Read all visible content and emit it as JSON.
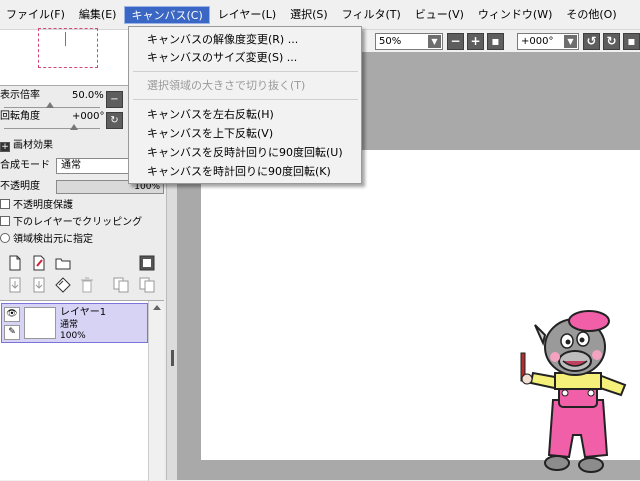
{
  "menubar": {
    "items": [
      {
        "label": "ファイル(F)",
        "active": false
      },
      {
        "label": "編集(E)",
        "active": false
      },
      {
        "label": "キャンバス(C)",
        "active": true
      },
      {
        "label": "レイヤー(L)",
        "active": false
      },
      {
        "label": "選択(S)",
        "active": false
      },
      {
        "label": "フィルタ(T)",
        "active": false
      },
      {
        "label": "ビュー(V)",
        "active": false
      },
      {
        "label": "ウィンドウ(W)",
        "active": false
      },
      {
        "label": "その他(O)",
        "active": false
      }
    ]
  },
  "canvas_menu": {
    "items": [
      {
        "label": "キャンバスの解像度変更(R) ...",
        "enabled": true
      },
      {
        "label": "キャンバスのサイズ変更(S) ...",
        "enabled": true
      },
      {
        "label": "選択領域の大きさで切り抜く(T)",
        "enabled": false
      },
      {
        "label": "キャンバスを左右反転(H)",
        "enabled": true
      },
      {
        "label": "キャンバスを上下反転(V)",
        "enabled": true
      },
      {
        "label": "キャンバスを反時計回りに90度回転(U)",
        "enabled": true
      },
      {
        "label": "キャンバスを時計回りに90度回転(K)",
        "enabled": true
      }
    ]
  },
  "toolbar": {
    "zoom_value": "50%",
    "rotation_value": "+000°"
  },
  "left_panel": {
    "zoom_label": "表示倍率",
    "zoom_value": "50.0%",
    "rotation_label": "回転角度",
    "rotation_value": "+000°",
    "texture_label": "画材効果",
    "blend_mode_label": "合成モード",
    "blend_mode_value": "通常",
    "opacity_label": "不透明度",
    "opacity_value": "100%",
    "opacity_level": 1.0,
    "protect_opacity_label": "不透明度保護",
    "clip_label": "下のレイヤーでクリッピング",
    "selection_source_label": "領域検出元に指定"
  },
  "layers": [
    {
      "name": "レイヤー1",
      "mode": "通常",
      "opacity": "100%",
      "selected": true
    }
  ],
  "colors": {
    "menu_active": "#3a66c4",
    "layer_selected": "#d6d3f5",
    "workspace": "#a9a9a9",
    "navigator_rect": "#d4467a"
  },
  "icons": {
    "mascot": "rhino-painter-mascot"
  }
}
